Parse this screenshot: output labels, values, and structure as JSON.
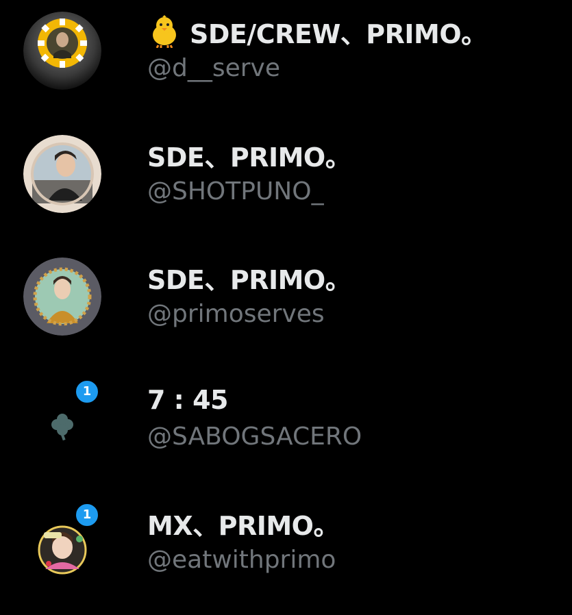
{
  "accounts": [
    {
      "display_name": "SDE/CREW、PRIMO。",
      "handle": "@d__serve",
      "emoji": "chick-icon",
      "badge": ""
    },
    {
      "display_name": "SDE、PRIMO。",
      "handle": "@SHOTPUNO_",
      "emoji": "",
      "badge": ""
    },
    {
      "display_name": "SDE、PRIMO。",
      "handle": "@primoserves",
      "emoji": "",
      "badge": ""
    },
    {
      "display_name": "7 : 45",
      "handle": "@SABOGSACERO",
      "emoji": "",
      "badge": "1"
    },
    {
      "display_name": "MX、PRIMO。",
      "handle": "@eatwithprimo",
      "emoji": "",
      "badge": "1"
    }
  ],
  "colors": {
    "background": "#000000",
    "name_text": "#e7e9ea",
    "handle_text": "#71767b",
    "badge": "#1d9bf0"
  }
}
